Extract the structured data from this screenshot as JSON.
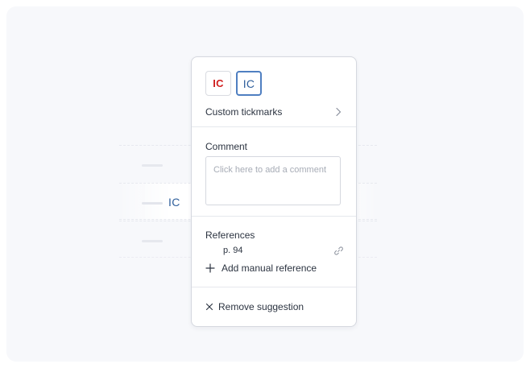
{
  "background": {
    "row_code": "IC"
  },
  "popover": {
    "tickmarks": {
      "red_label": "IC",
      "blue_label": "IC",
      "custom_label": "Custom tickmarks"
    },
    "comment": {
      "title": "Comment",
      "placeholder": "Click here to add a comment",
      "value": ""
    },
    "references": {
      "title": "References",
      "items": [
        {
          "page": "p. 94"
        }
      ],
      "add_label": "Add manual reference"
    },
    "remove_label": "Remove suggestion"
  },
  "colors": {
    "tick_red": "#d01f1f",
    "tick_blue": "#2f5f9c",
    "selected_border": "#4f7fc1"
  },
  "icons": [
    "chevron-right-icon",
    "link-icon",
    "plus-icon",
    "close-icon"
  ]
}
